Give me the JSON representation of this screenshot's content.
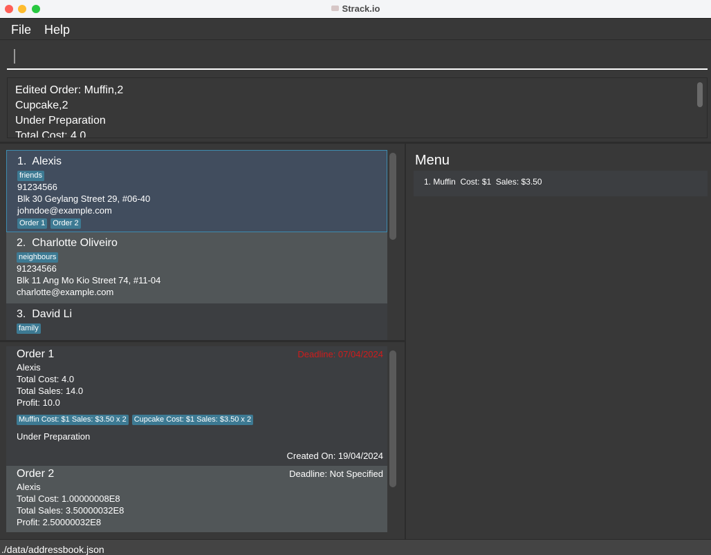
{
  "window": {
    "title": "Strack.io"
  },
  "menubar": {
    "items": [
      "File",
      "Help"
    ]
  },
  "command": {
    "value": "",
    "placeholder": ""
  },
  "result": {
    "lines": [
      "Edited Order: Muffin,2",
      "Cupcake,2",
      "Under Preparation",
      "Total Cost: 4.0"
    ]
  },
  "persons": [
    {
      "index": "1.",
      "name": "Alexis",
      "tags": [
        "friends"
      ],
      "phone": "91234566",
      "address": "Blk 30 Geylang Street 29, #06-40",
      "email": "johndoe@example.com",
      "orders": [
        "Order 1",
        "Order 2"
      ],
      "selected": true
    },
    {
      "index": "2.",
      "name": "Charlotte Oliveiro",
      "tags": [
        "neighbours"
      ],
      "phone": "91234566",
      "address": "Blk 11 Ang Mo Kio Street 74, #11-04",
      "email": "charlotte@example.com",
      "orders": []
    },
    {
      "index": "3.",
      "name": "David Li",
      "tags": [
        "family"
      ]
    }
  ],
  "orders": [
    {
      "title": "Order 1",
      "deadline": "Deadline: 07/04/2024",
      "deadline_color": "#d01c1c",
      "customer": "Alexis",
      "total_cost": "Total Cost: 4.0",
      "total_sales": "Total Sales: 14.0",
      "profit": "Profit: 10.0",
      "items": [
        "Muffin Cost: $1 Sales: $3.50 x 2",
        "Cupcake Cost: $1 Sales: $3.50 x 2"
      ],
      "status": "Under Preparation",
      "created": "Created On: 19/04/2024"
    },
    {
      "title": "Order 2",
      "deadline": "Deadline: Not Specified",
      "customer": "Alexis",
      "total_cost": "Total Cost: 1.00000008E8",
      "total_sales": "Total Sales: 3.50000032E8",
      "profit": "Profit: 2.50000032E8"
    }
  ],
  "menu": {
    "title": "Menu",
    "items": [
      "1. Muffin  Cost: $1  Sales: $3.50"
    ]
  },
  "status": {
    "path": "./data/addressbook.json"
  },
  "colors": {
    "tag": "#3d7a93",
    "selected_border": "#3e8caf",
    "deadline_overdue": "#d01c1c"
  }
}
